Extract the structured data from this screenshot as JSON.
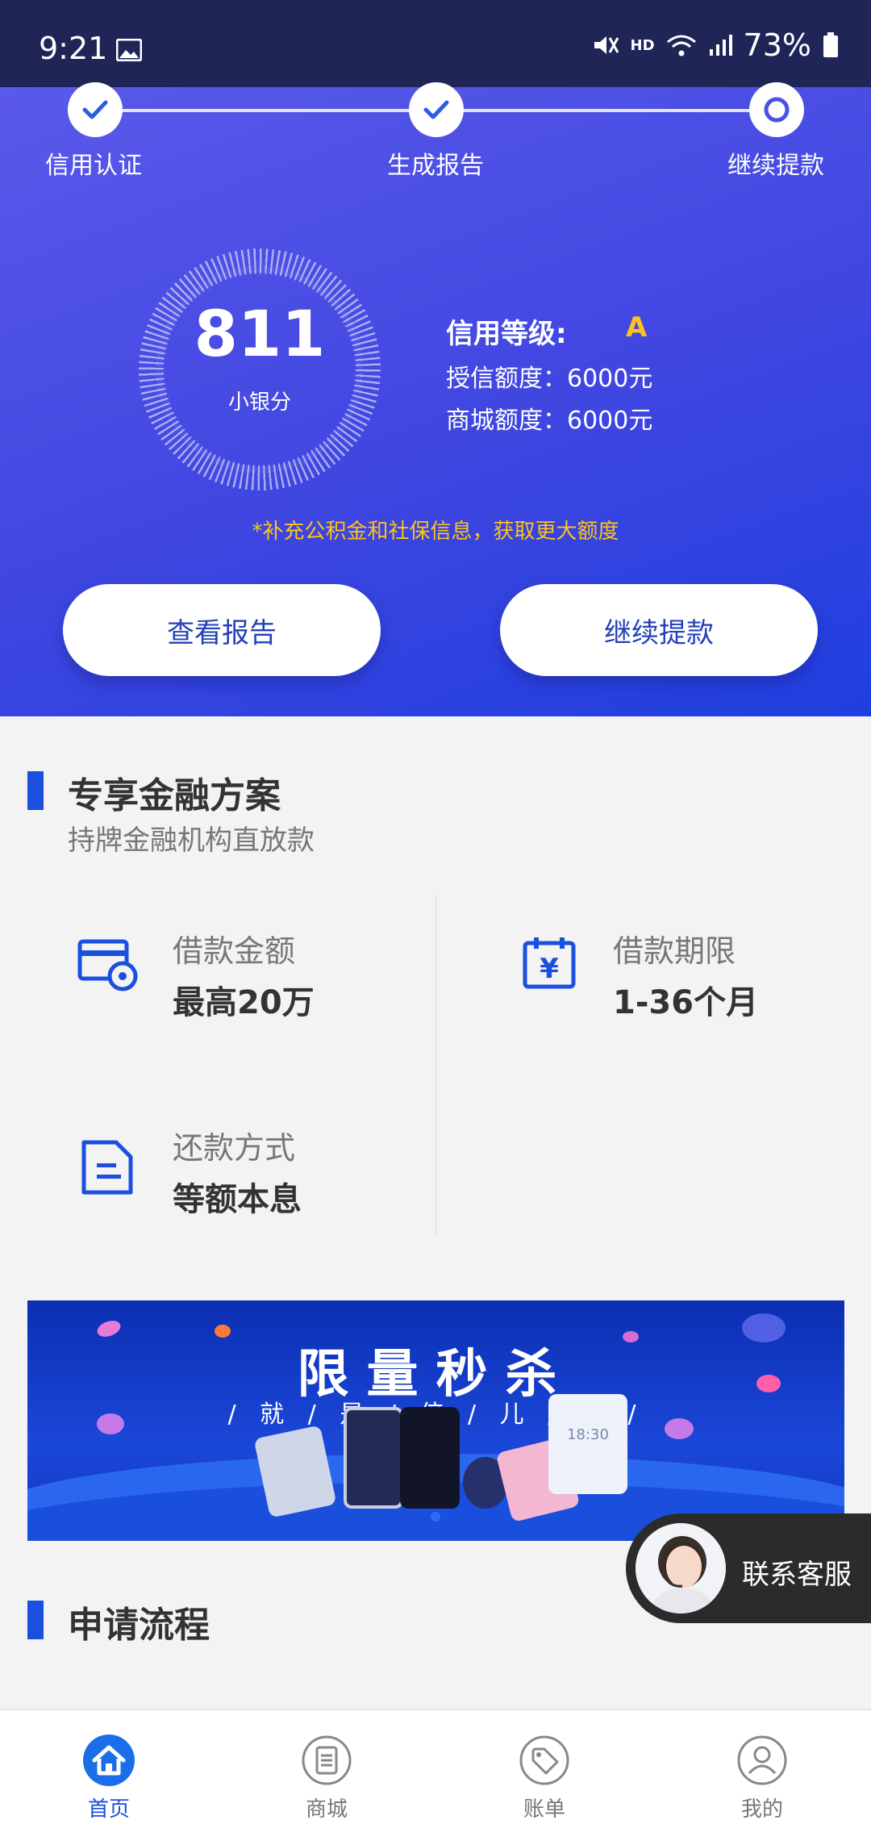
{
  "status_bar": {
    "time": "9:21",
    "battery": "73%",
    "network": "HD"
  },
  "steps": [
    {
      "label": "信用认证",
      "state": "done"
    },
    {
      "label": "生成报告",
      "state": "done"
    },
    {
      "label": "继续提款",
      "state": "current"
    }
  ],
  "score": {
    "value": "811",
    "unit": "小银分"
  },
  "credit": {
    "grade_label": "信用等级:",
    "grade": "A",
    "limit_line": "授信额度：6000元",
    "mall_line": "商城额度：6000元"
  },
  "tip": "*补充公积金和社保信息，获取更大额度",
  "buttons": {
    "view_report": "查看报告",
    "continue_withdraw": "继续提款"
  },
  "finance": {
    "title": "专享金融方案",
    "subtitle": "持牌金融机构直放款",
    "features": [
      {
        "label": "借款金额",
        "value": "最高20万",
        "icon": "card-icon"
      },
      {
        "label": "借款期限",
        "value": "1-36个月",
        "icon": "calendar-yen-icon"
      },
      {
        "label": "还款方式",
        "value": "等额本息",
        "icon": "document-icon"
      }
    ]
  },
  "banner": {
    "title": "限量秒杀",
    "subtitle": "/ 就 / 是 / 倍 / 儿 / 爽 /",
    "phone_screen_time": "18:30"
  },
  "customer_service": {
    "label": "联系客服"
  },
  "process": {
    "title": "申请流程"
  },
  "nav": [
    {
      "label": "首页",
      "icon": "home-icon",
      "active": true
    },
    {
      "label": "商城",
      "icon": "mall-icon",
      "active": false
    },
    {
      "label": "账单",
      "icon": "tag-icon",
      "active": false
    },
    {
      "label": "我的",
      "icon": "user-icon",
      "active": false
    }
  ],
  "colors": {
    "accent": "#1a4fe0",
    "grade": "#ffc21a",
    "status_bar": "#1f2556"
  }
}
